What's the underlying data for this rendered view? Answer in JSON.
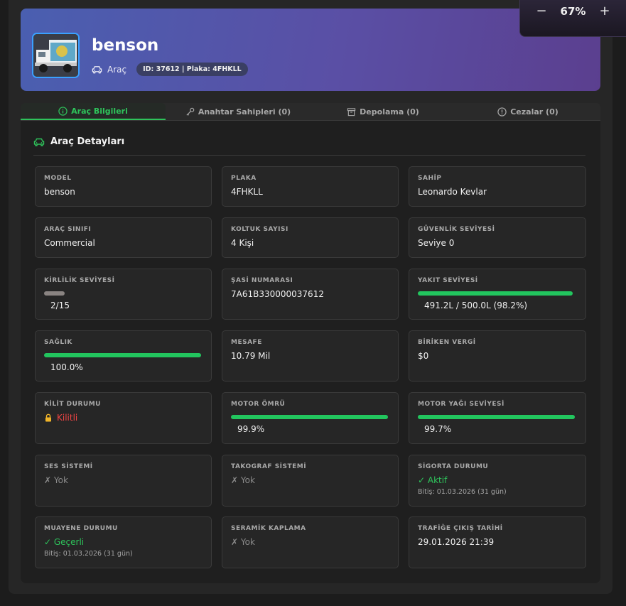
{
  "zoom": {
    "minus": "−",
    "value": "67%",
    "plus": "+"
  },
  "header": {
    "title": "benson",
    "type": "Araç",
    "id_label": "ID: 37612 | Plaka: 4FHKLL"
  },
  "tabs": [
    {
      "label": "Araç Bilgileri"
    },
    {
      "label": "Anahtar Sahipleri (0)"
    },
    {
      "label": "Depolama (0)"
    },
    {
      "label": "Cezalar (0)"
    }
  ],
  "section": {
    "title": "Araç Detayları"
  },
  "cards": {
    "model": {
      "label": "MODEL",
      "value": "benson"
    },
    "plaka": {
      "label": "PLAKA",
      "value": "4FHKLL"
    },
    "sahip": {
      "label": "SAHİP",
      "value": "Leonardo Kevlar"
    },
    "sinif": {
      "label": "ARAÇ SINIFI",
      "value": "Commercial"
    },
    "koltuk": {
      "label": "KOLTUK SAYISI",
      "value": "4 Kişi"
    },
    "guvenlik": {
      "label": "GÜVENLİK SEVİYESİ",
      "value": "Seviye 0"
    },
    "kirlilik": {
      "label": "KİRLİLİK SEVİYESİ",
      "value": "2/15",
      "fraction": 0.1333
    },
    "sasi": {
      "label": "ŞASİ NUMARASI",
      "value": "7A61B330000037612"
    },
    "yakit": {
      "label": "YAKIT SEVİYESİ",
      "value": "491.2L / 500.0L (98.2%)",
      "fraction": 0.982
    },
    "saglik": {
      "label": "SAĞLIK",
      "value": "100.0%",
      "fraction": 1.0
    },
    "mesafe": {
      "label": "MESAFE",
      "value": "10.79 Mil"
    },
    "vergi": {
      "label": "BİRİKEN VERGİ",
      "value": "$0"
    },
    "kilit": {
      "label": "KİLİT DURUMU",
      "value": "Kilitli",
      "icon": "lock-icon"
    },
    "motor": {
      "label": "MOTOR ÖMRÜ",
      "value": "99.9%",
      "fraction": 0.999
    },
    "yag": {
      "label": "MOTOR YAĞI SEVİYESİ",
      "value": "99.7%",
      "fraction": 0.997
    },
    "ses": {
      "label": "SES SİSTEMİ",
      "value": "✗ Yok"
    },
    "takograf": {
      "label": "TAKOGRAF SİSTEMİ",
      "value": "✗ Yok"
    },
    "sigorta": {
      "label": "SİGORTA DURUMU",
      "value": "✓ Aktif",
      "sub": "Bitiş: 01.03.2026 (31 gün)"
    },
    "muayene": {
      "label": "MUAYENE DURUMU",
      "value": "✓ Geçerli",
      "sub": "Bitiş: 01.03.2026 (31 gün)"
    },
    "seramik": {
      "label": "SERAMİK KAPLAMA",
      "value": "✗ Yok"
    },
    "trafik": {
      "label": "TRAFİĞE ÇIKIŞ TARİHİ",
      "value": "29.01.2026 21:39"
    }
  },
  "colors": {
    "accent": "#2ec35b",
    "bar": "#22c55e",
    "danger": "#ef4444",
    "header_start": "#4a5fb0",
    "header_end": "#5b3f8f"
  }
}
